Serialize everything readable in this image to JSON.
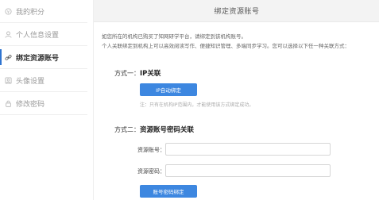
{
  "sidebar": {
    "items": [
      {
        "label": "我的积分",
        "icon": "points-icon",
        "active": false
      },
      {
        "label": "个人信息设置",
        "icon": "user-icon",
        "active": false
      },
      {
        "label": "绑定资源账号",
        "icon": "link-icon",
        "active": true
      },
      {
        "label": "头像设置",
        "icon": "avatar-icon",
        "active": false
      },
      {
        "label": "修改密码",
        "icon": "lock-icon",
        "active": false
      }
    ]
  },
  "main": {
    "title": "绑定资源账号",
    "notice_line1": "如您所在的机构已购买了知网研学平台，请绑定到该机构账号。",
    "notice_line2": "个人关联绑定到机构上可以高效阅读写作、便捷知识管理、多端同步学习。您可以选择以下任一种关联方式：",
    "method1": {
      "prefix": "方式一：",
      "title": "IP关联",
      "button_label": "IP自动绑定",
      "hint": "注：只有在机构IP范围内，才能使用该方式绑定成功。"
    },
    "method2": {
      "prefix": "方式二：",
      "title": "资源账号密码关联",
      "account_label": "资源账号：",
      "account_value": "",
      "password_label": "资源密码：",
      "password_value": "",
      "button_label": "账号密码绑定"
    }
  },
  "colors": {
    "accent": "#3d87e0",
    "active_marker": "#2f74d0",
    "header_bg": "#f3f3f3"
  }
}
